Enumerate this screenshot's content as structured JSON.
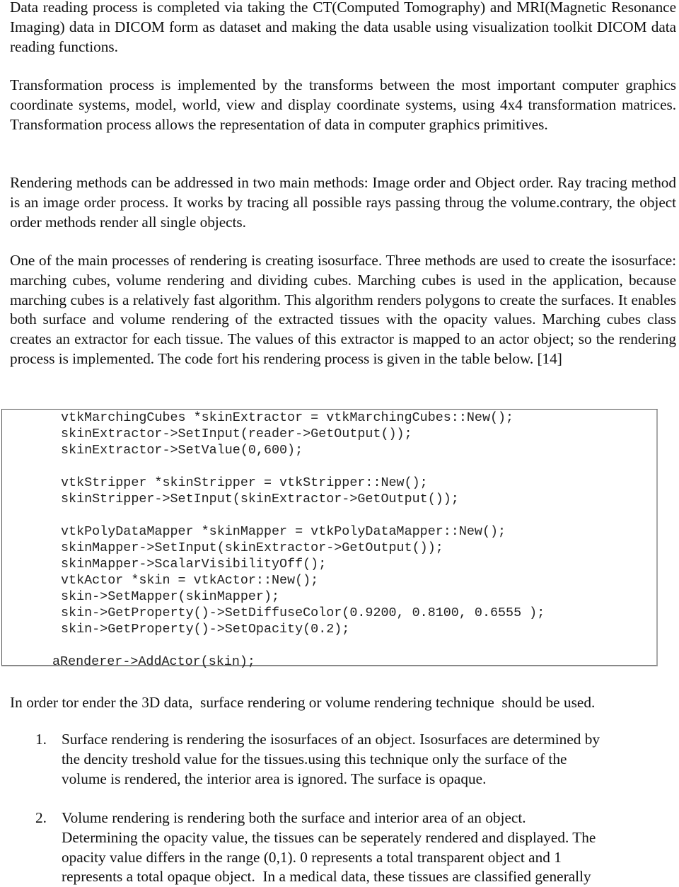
{
  "paragraphs": {
    "data_reading": "Data reading process is completed via taking the CT(Computed Tomography) and MRI(Magnetic Resonance Imaging) data in DICOM form as dataset and making the data usable using visualization toolkit DICOM data reading functions.",
    "transformation": "Transformation process is implemented by the transforms between the most important computer graphics coordinate systems, model, world, view and display coordinate systems, using 4x4 transformation matrices. Transformation process allows the representation of data in computer graphics primitives.",
    "rendering_methods": "Rendering methods can be addressed in two main methods: Image order and Object order. Ray tracing method is an image order process. It works by tracing all possible rays passing throug the volume.contrary, the object order methods render all single objects.",
    "isosurface": "One of the main processes of rendering is creating isosurface. Three methods are used to create the isosurface: marching cubes, volume rendering and dividing cubes. Marching cubes is used in the application, because marching cubes is a relatively fast algorithm. This algorithm renders polygons to create the surfaces. It enables both surface and volume rendering of the extracted tissues with the opacity values. Marching cubes class creates an extractor for each tissue. The values of this extractor is mapped to an actor object; so the rendering process is implemented. The code fort his rendering process is given in the table below. [14]",
    "render_3d": "In order tor ender the 3D data,  surface rendering or volume rendering technique  should be used."
  },
  "code_block": {
    "lines": [
      "vtkMarchingCubes *skinExtractor = vtkMarchingCubes::New();",
      "skinExtractor->SetInput(reader->GetOutput());",
      "skinExtractor->SetValue(0,600);",
      "",
      "vtkStripper *skinStripper = vtkStripper::New();",
      "skinStripper->SetInput(skinExtractor->GetOutput());",
      "",
      "vtkPolyDataMapper *skinMapper = vtkPolyDataMapper::New();",
      "skinMapper->SetInput(skinExtractor->GetOutput());",
      "skinMapper->ScalarVisibilityOff();",
      "vtkActor *skin = vtkActor::New();",
      "skin->SetMapper(skinMapper);",
      "skin->GetProperty()->SetDiffuseColor(0.9200, 0.8100, 0.6555 );",
      "skin->GetProperty()->SetOpacity(0.2);",
      "",
      "aRenderer->AddActor(skin);"
    ]
  },
  "list": {
    "items": [
      {
        "number": "1.",
        "lines": [
          "Surface rendering is rendering the isosurfaces of an object. Isosurfaces are determined by",
          "the dencity treshold value for the tissues.using this technique only the surface of the",
          "volume is rendered, the interior area is ignored. The surface is opaque."
        ]
      },
      {
        "number": "2.",
        "lines": [
          "Volume rendering is rendering both the surface and interior area of an object.",
          "Determining the opacity value, the tissues can be seperately rendered and displayed. The",
          "opacity value differs in the range (0,1). 0 represents a total transparent object and 1",
          "represents a total opaque object.  In a medical data, these tissues are classified generally"
        ]
      }
    ]
  }
}
